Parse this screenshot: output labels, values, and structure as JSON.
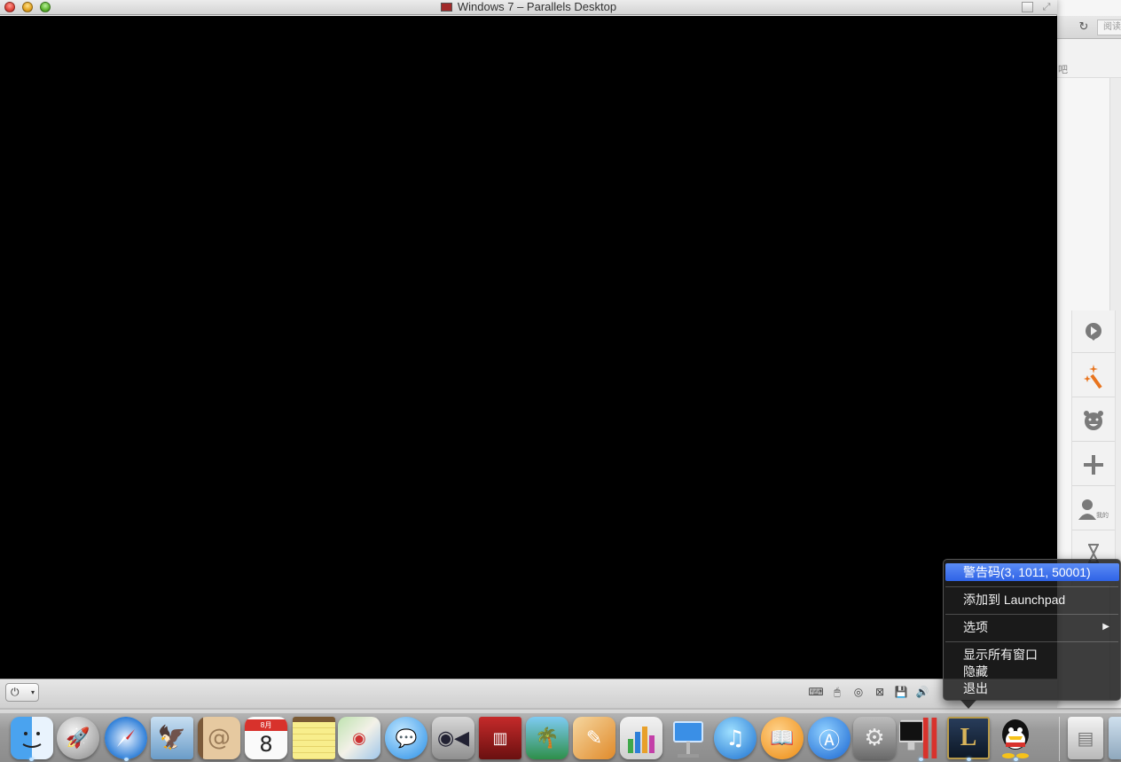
{
  "vm_window": {
    "title": "Windows 7 – Parallels Desktop",
    "power_glyph": "⏻",
    "power_caret": "▾",
    "status_icons": [
      "keyboard-icon",
      "mouse-icon",
      "cd-icon",
      "network-icon",
      "floppy-icon",
      "speaker-icon"
    ]
  },
  "background_window": {
    "read_tab": "阅读",
    "bar_label": "吧"
  },
  "sidebar_tools": {
    "person_label": "我的"
  },
  "context_menu": {
    "items": [
      {
        "label": "警告码(3, 1011, 50001)",
        "highlighted": true
      },
      {
        "label": "添加到 Launchpad"
      },
      {
        "label": "选项",
        "has_submenu": true
      },
      {
        "label": "显示所有窗口"
      },
      {
        "label": "隐藏"
      },
      {
        "label": "退出"
      }
    ],
    "submenu_arrow": "▶"
  },
  "dock": {
    "calendar_day": "8",
    "calendar_month": "8月",
    "apps": [
      "Finder",
      "Launchpad",
      "Safari",
      "Mail",
      "Contacts",
      "Calendar",
      "Notes",
      "Maps",
      "Messages",
      "FaceTime",
      "Photo Booth",
      "iPhoto",
      "Pages",
      "Numbers",
      "Keynote",
      "iTunes",
      "iBooks",
      "App Store",
      "System Preferences",
      "Parallels Desktop",
      "League of Legends",
      "QQ",
      "Documents",
      "Trash"
    ]
  },
  "colors": {
    "menu_highlight": "#3a6ef0",
    "vm_screen": "#000000",
    "accent_orange": "#e8741e"
  }
}
